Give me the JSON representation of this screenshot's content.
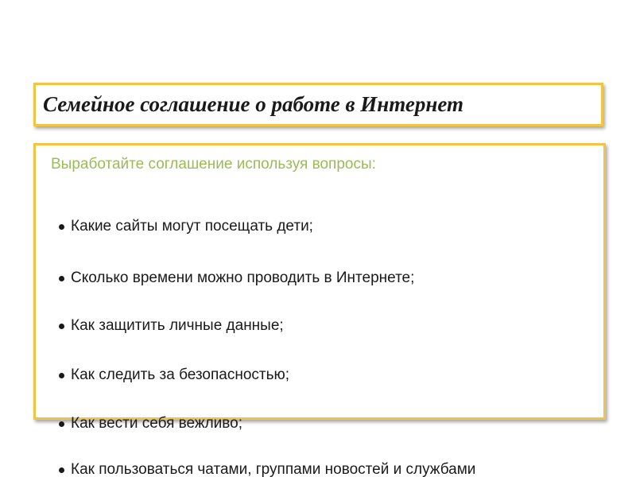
{
  "slide": {
    "title": "Семейное соглашение о работе в Интернет",
    "subtitle": "Выработайте соглашение используя вопросы:",
    "bullets": [
      "Какие сайты могут посещать  дети;",
      "Сколько времени можно проводить в Интернете;",
      "Как защитить личные данные;",
      "Как следить за безопасностью;",
      "Как вести себя вежливо;",
      "Как пользоваться чатами, группами новостей и службами"
    ]
  },
  "colors": {
    "border": "#f2c443",
    "subtitle": "#9bbb59",
    "text": "#1a1a1a"
  }
}
